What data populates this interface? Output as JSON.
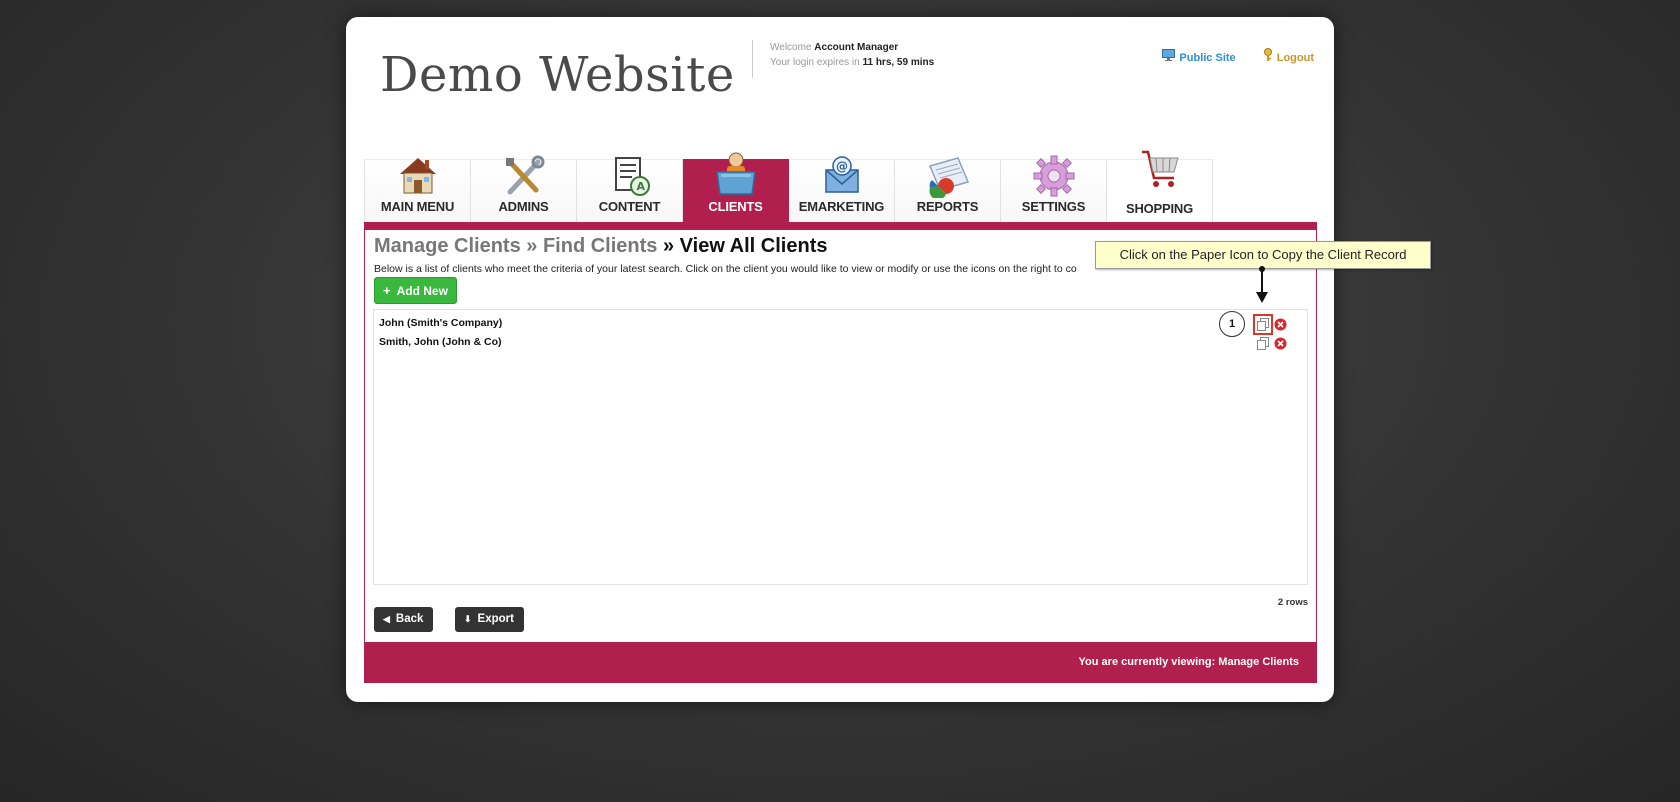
{
  "header": {
    "site_title": "Demo Website",
    "welcome_prefix": "Welcome",
    "user_name": "Account Manager",
    "expiry_prefix": "Your login expires in",
    "expiry_value": "11 hrs, 59 mins",
    "public_site_label": "Public Site",
    "logout_label": "Logout"
  },
  "nav": {
    "tabs": [
      {
        "label": "MAIN MENU",
        "icon": "house-icon"
      },
      {
        "label": "ADMINS",
        "icon": "tools-icon"
      },
      {
        "label": "CONTENT",
        "icon": "document-icon"
      },
      {
        "label": "CLIENTS",
        "icon": "person-folder-icon",
        "active": true
      },
      {
        "label": "EMARKETING",
        "icon": "email-icon"
      },
      {
        "label": "REPORTS",
        "icon": "report-icon"
      },
      {
        "label": "SETTINGS",
        "icon": "gear-icon"
      },
      {
        "label": "SHOPPING",
        "icon": "cart-icon"
      }
    ]
  },
  "main": {
    "breadcrumb": {
      "part1": "Manage Clients",
      "sep": " » ",
      "part2": "Find Clients",
      "current": "View All Clients"
    },
    "intro_text": "Below is a list of clients who meet the criteria of your latest search. Click on the client you would like to view or modify or use the icons on the right to co",
    "add_new_label": "Add New",
    "clients": [
      {
        "name": "John (Smith's Company)"
      },
      {
        "name": "Smith, John (John & Co)"
      }
    ],
    "row_count": "2 rows",
    "back_label": "Back",
    "export_label": "Export"
  },
  "tooltip": {
    "text": "Click on the Paper Icon to Copy the Client Record",
    "step_number": "1"
  },
  "footer": {
    "status_text": "You are currently viewing: Manage Clients"
  },
  "colors": {
    "accent": "#b01f4e",
    "add_button": "#3ab83d",
    "dark_button": "#333333",
    "link_blue": "#2d8ed6",
    "logout_gold": "#c9962d"
  }
}
